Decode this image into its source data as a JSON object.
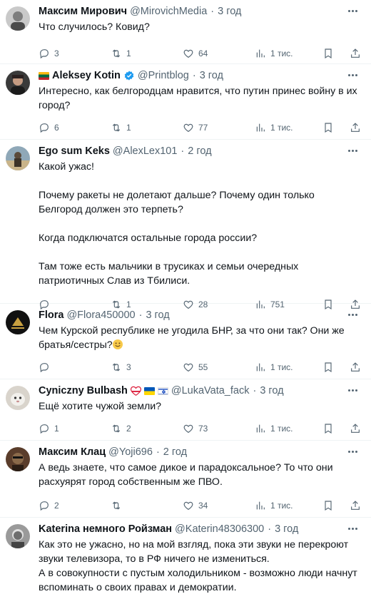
{
  "tweets": [
    {
      "name": "Максим Мирович",
      "handle": "@MirovichMedia",
      "time": "3 год",
      "text": "Что случилось? Ковид?",
      "replies": "3",
      "retweets": "1",
      "likes": "64",
      "views": "1 тис."
    },
    {
      "name": "Aleksey Kotin",
      "handle": "@Printblog",
      "time": "3 год",
      "text": "Интересно, как белгородцам нравится, что путин принес войну в их город?",
      "replies": "6",
      "retweets": "1",
      "likes": "77",
      "views": "1 тис."
    },
    {
      "name": "Ego sum Keks",
      "handle": "@AlexLex101",
      "time": "2 год",
      "text": "Какой ужас!\n\nПочему ракеты не долетают дальше? Почему один только Белгород должен это терпеть?\n\nКогда подключатся остальные города россии?\n\nТам тоже есть мальчики в трусиках и семьи очередных патриотичных Слав из Тбилиси.",
      "replies": "",
      "retweets": "1",
      "likes": "28",
      "views": "751"
    },
    {
      "name": "Flora",
      "handle": "@Flora450000",
      "time": "3 год",
      "text": "Чем Курской республике не угодила БНР, за что они так? Они же братья/сестры?",
      "replies": "",
      "retweets": "3",
      "likes": "55",
      "views": "1 тис."
    },
    {
      "name": "Cyniczny Bulbash",
      "handle": "@LukaVata_fack",
      "time": "3 год",
      "text": "Ещё хотите чужой земли?",
      "replies": "1",
      "retweets": "2",
      "likes": "73",
      "views": "1 тис."
    },
    {
      "name": "Максим Клац",
      "handle": "@Yoji696",
      "time": "2 год",
      "text": "А ведь знаете, что самое дикое и парадоксальное? То что они расхуярят город собственным же ПВО.",
      "replies": "2",
      "retweets": "",
      "likes": "34",
      "views": "1 тис."
    },
    {
      "name": "Katerina немного Ройзман",
      "handle": "@Katerin48306300",
      "time": "3 год",
      "text": "Как это не ужасно, но на мой взгляд, пока эти звуки не перекроют звуки телевизора, то в РФ ничего не измениться.\nА в совокупности с пустым холодильником - возможно люди начнут вспоминать о своих правах и демократии.",
      "replies": "",
      "retweets": "",
      "likes": "",
      "views": ""
    }
  ],
  "colors": {
    "verified": "#1d9bf0",
    "muted": "#536471",
    "text": "#0f1419",
    "divider": "#eff3f4"
  },
  "icons": [
    "reply-icon",
    "retweet-icon",
    "like-icon",
    "views-icon",
    "bookmark-icon",
    "share-icon",
    "more-icon",
    "verified-badge-icon",
    "lithuania-flag-icon",
    "heart-emoji-icon",
    "ukraine-flag-icon",
    "israel-flag-icon",
    "smile-emoji-icon"
  ]
}
